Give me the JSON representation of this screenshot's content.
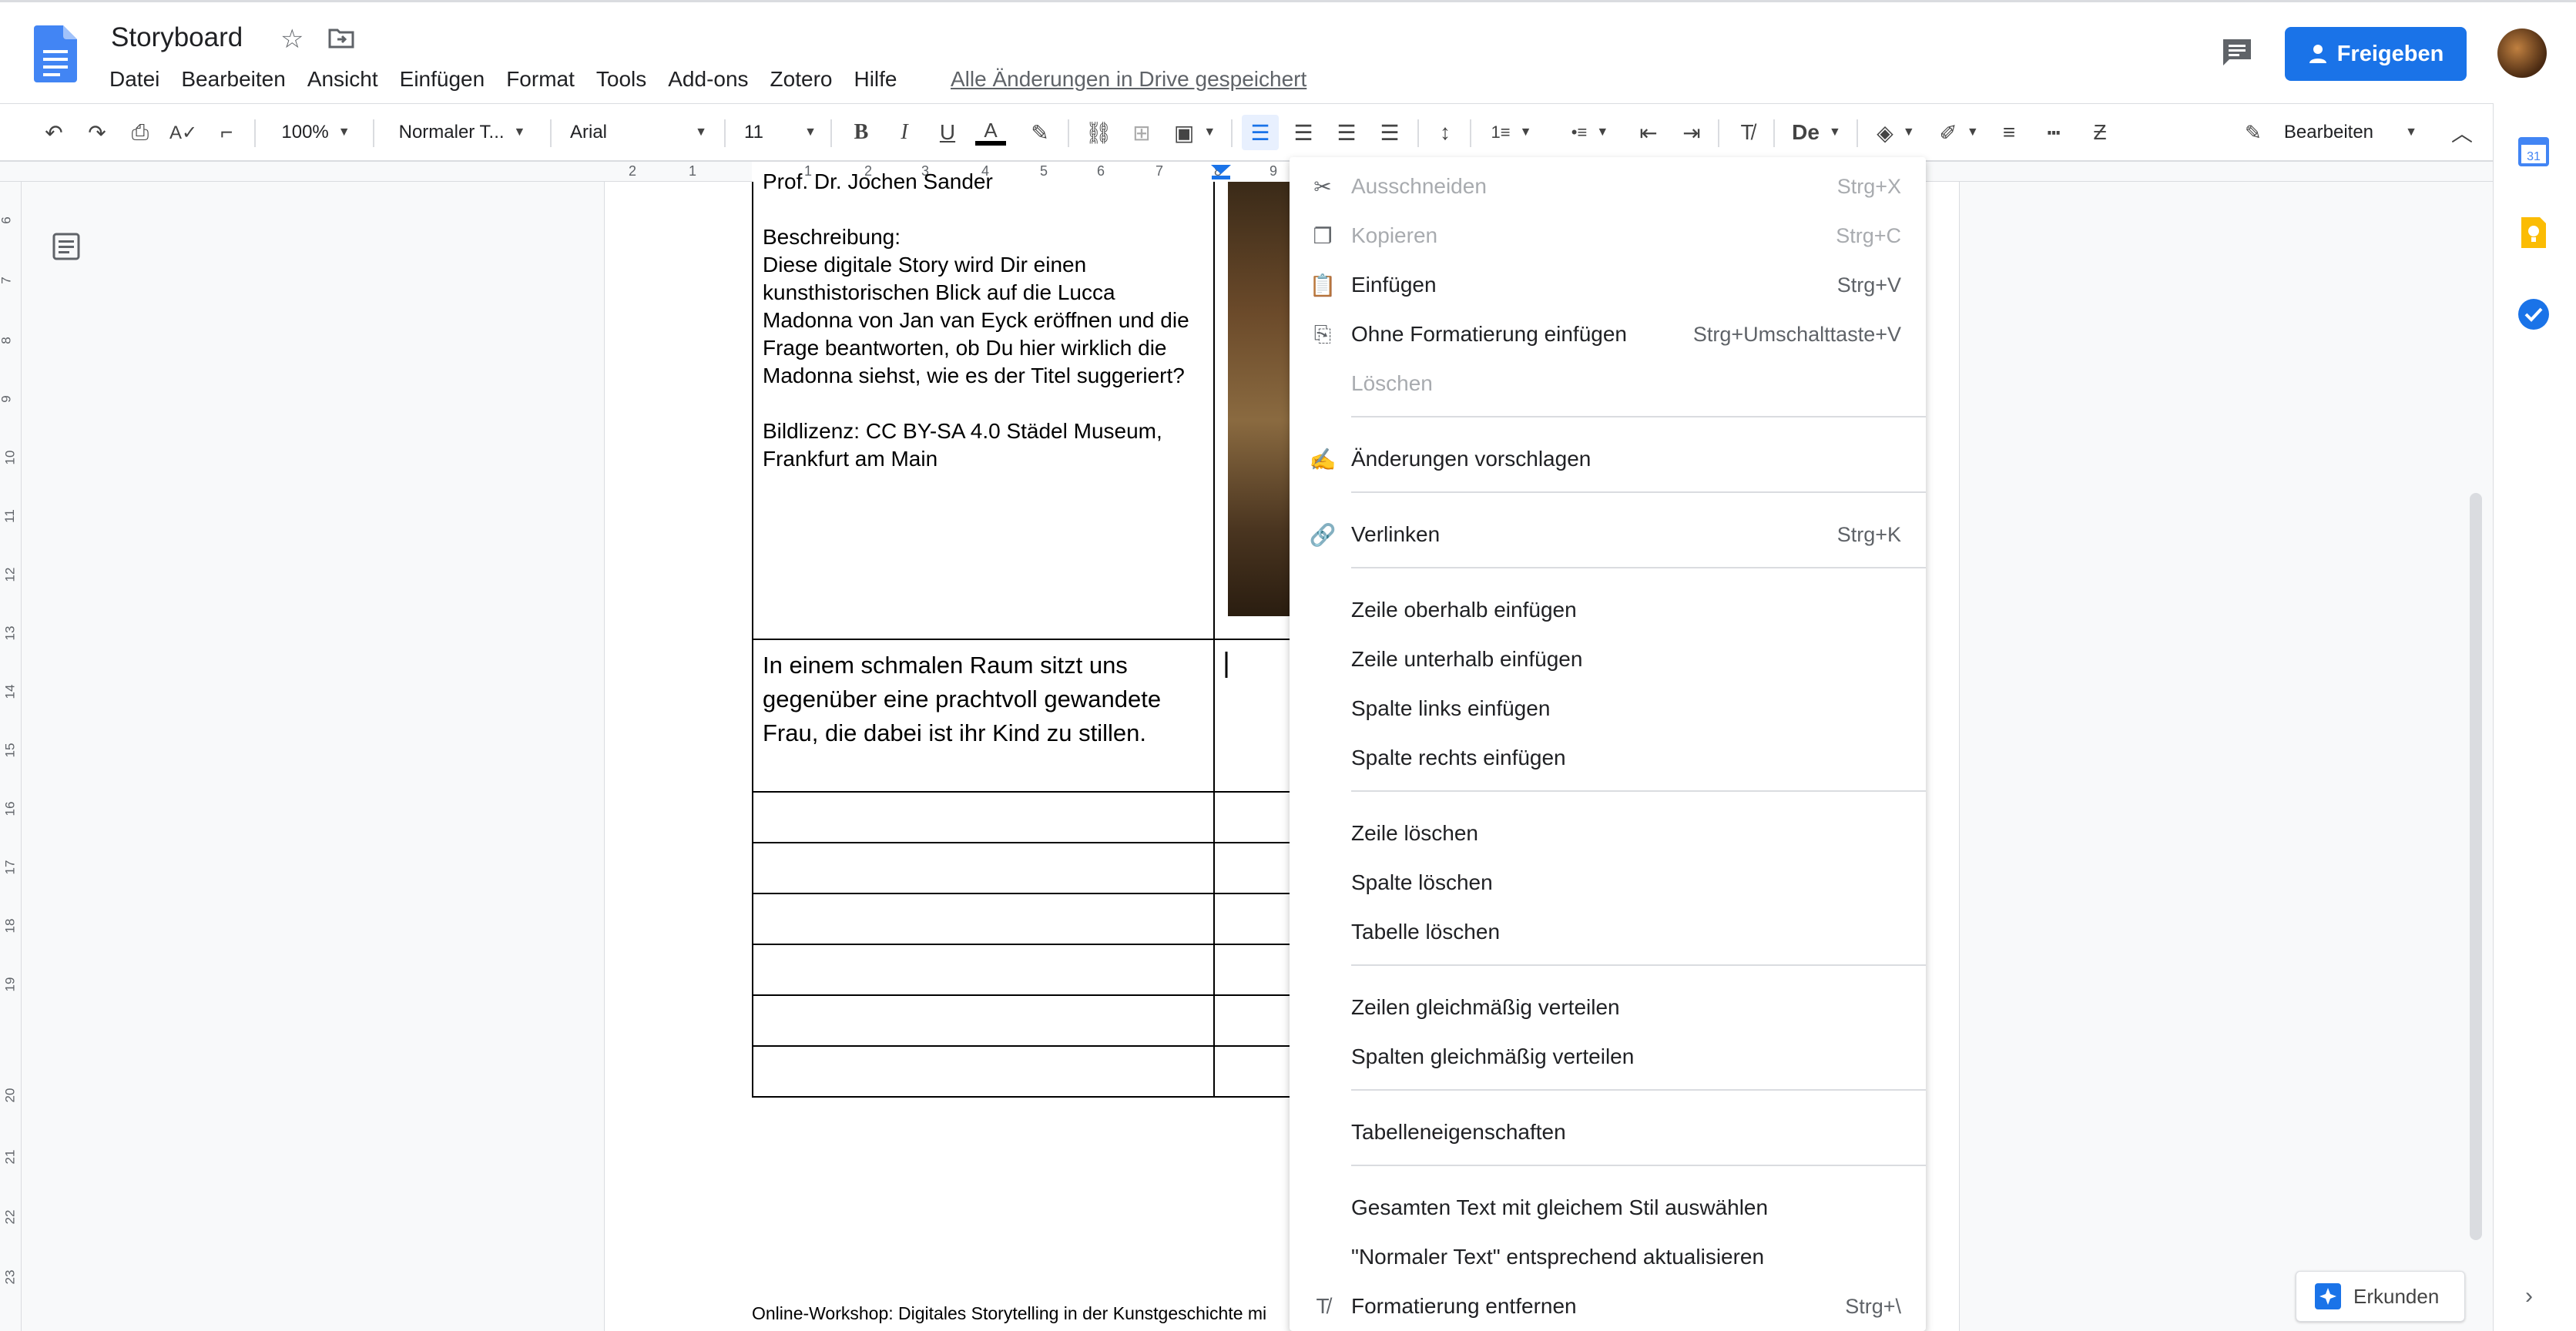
{
  "doc": {
    "title": "Storyboard",
    "saved_status": "Alle Änderungen in Drive gespeichert"
  },
  "menu": [
    "Datei",
    "Bearbeiten",
    "Ansicht",
    "Einfügen",
    "Format",
    "Tools",
    "Add-ons",
    "Zotero",
    "Hilfe"
  ],
  "share": {
    "label": "Freigeben"
  },
  "toolbar": {
    "zoom": "100%",
    "style": "Normaler T...",
    "font": "Arial",
    "size": "11",
    "mode": "Bearbeiten"
  },
  "ruler_labels": [
    "2",
    "1",
    "1",
    "2",
    "3",
    "4",
    "5",
    "6",
    "7",
    "8",
    "9"
  ],
  "vruler_labels": [
    "6",
    "7",
    "8",
    "9",
    "10",
    "11",
    "12",
    "13",
    "14",
    "15",
    "16",
    "17",
    "18",
    "19",
    "20",
    "21",
    "22",
    "23"
  ],
  "table": {
    "cell1": {
      "top_line": "Prof. Dr. Jochen Sander",
      "heading": "Beschreibung:",
      "body": "Diese digitale Story wird Dir einen kunsthistorischen Blick auf die Lucca Madonna von Jan van Eyck eröffnen und die Frage beantworten, ob Du hier wirklich die Madonna siehst, wie es der Titel suggeriert?",
      "license": "Bildlizenz: CC BY-SA 4.0 Städel Museum, Frankfurt am Main"
    },
    "cell2": "In einem schmalen Raum sitzt uns gegenüber eine prachtvoll gewandete Frau, die dabei ist ihr Kind zu stillen."
  },
  "footer_text": "Online-Workshop: Digitales Storytelling in der Kunstgeschichte mi",
  "context_menu": {
    "items": [
      {
        "label": "Ausschneiden",
        "shortcut": "Strg+X",
        "icon": "scissors-icon",
        "disabled": true
      },
      {
        "label": "Kopieren",
        "shortcut": "Strg+C",
        "icon": "copy-icon",
        "disabled": true
      },
      {
        "label": "Einfügen",
        "shortcut": "Strg+V",
        "icon": "paste-icon",
        "disabled": false
      },
      {
        "label": "Ohne Formatierung einfügen",
        "shortcut": "Strg+Umschalttaste+V",
        "icon": "paste-plain-icon",
        "disabled": false
      },
      {
        "label": "Löschen",
        "shortcut": "",
        "icon": "",
        "disabled": true
      },
      {
        "label": "Änderungen vorschlagen",
        "shortcut": "",
        "icon": "suggest-edit-icon",
        "disabled": false
      },
      {
        "label": "Verlinken",
        "shortcut": "Strg+K",
        "icon": "link-icon",
        "disabled": false
      },
      {
        "label": "Zeile oberhalb einfügen",
        "shortcut": "",
        "icon": "",
        "disabled": false
      },
      {
        "label": "Zeile unterhalb einfügen",
        "shortcut": "",
        "icon": "",
        "disabled": false
      },
      {
        "label": "Spalte links einfügen",
        "shortcut": "",
        "icon": "",
        "disabled": false
      },
      {
        "label": "Spalte rechts einfügen",
        "shortcut": "",
        "icon": "",
        "disabled": false
      },
      {
        "label": "Zeile löschen",
        "shortcut": "",
        "icon": "",
        "disabled": false
      },
      {
        "label": "Spalte löschen",
        "shortcut": "",
        "icon": "",
        "disabled": false
      },
      {
        "label": "Tabelle löschen",
        "shortcut": "",
        "icon": "",
        "disabled": false
      },
      {
        "label": "Zeilen gleichmäßig verteilen",
        "shortcut": "",
        "icon": "",
        "disabled": false
      },
      {
        "label": "Spalten gleichmäßig verteilen",
        "shortcut": "",
        "icon": "",
        "disabled": false
      },
      {
        "label": "Tabelleneigenschaften",
        "shortcut": "",
        "icon": "",
        "disabled": false
      },
      {
        "label": "Gesamten Text mit gleichem Stil auswählen",
        "shortcut": "",
        "icon": "",
        "disabled": false
      },
      {
        "label": "\"Normaler Text\" entsprechend aktualisieren",
        "shortcut": "",
        "icon": "",
        "disabled": false
      },
      {
        "label": "Formatierung entfernen",
        "shortcut": "Strg+\\",
        "icon": "clear-format-icon",
        "disabled": false
      }
    ]
  },
  "explore": {
    "label": "Erkunden"
  },
  "colors": {
    "accent": "#1a73e8",
    "docs_blue": "#4285f4"
  }
}
